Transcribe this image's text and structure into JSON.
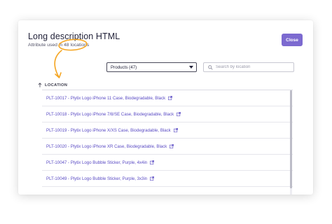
{
  "dialog": {
    "title": "Long description HTML",
    "subtitle": "Attribute used in 48 locations",
    "close_label": "Close"
  },
  "filter": {
    "selected": "Products (47)"
  },
  "search": {
    "placeholder": "Search by location"
  },
  "table": {
    "column_header": "LOCATION",
    "sort": "ascending",
    "rows": [
      "PLT-10017 - Plytix Logo iPhone 11 Case, Biodegradable, Black",
      "PLT-10018 - Plytix Logo iPhone 7/8/SE Case, Biodegradable, Black",
      "PLT-10019 - Plytix Logo iPhone X/XS Case, Biodegradable, Black",
      "PLT-10020 - Plytix Logo iPhone XR Case, Biodegradable, Black",
      "PLT-10047 - Plytix Logo Bubble Sticker, Purple, 4x4in",
      "PLT-10049 - Plytix Logo Bubble Sticker, Purple, 3x3in"
    ]
  },
  "colors": {
    "accent": "#7c6ad0",
    "link": "#5a4bc4",
    "annotation": "#f5a623"
  },
  "icons": {
    "external": "external-link-icon",
    "search": "search-icon",
    "sort": "arrow-up-icon",
    "dropdown": "chevron-down-icon"
  }
}
